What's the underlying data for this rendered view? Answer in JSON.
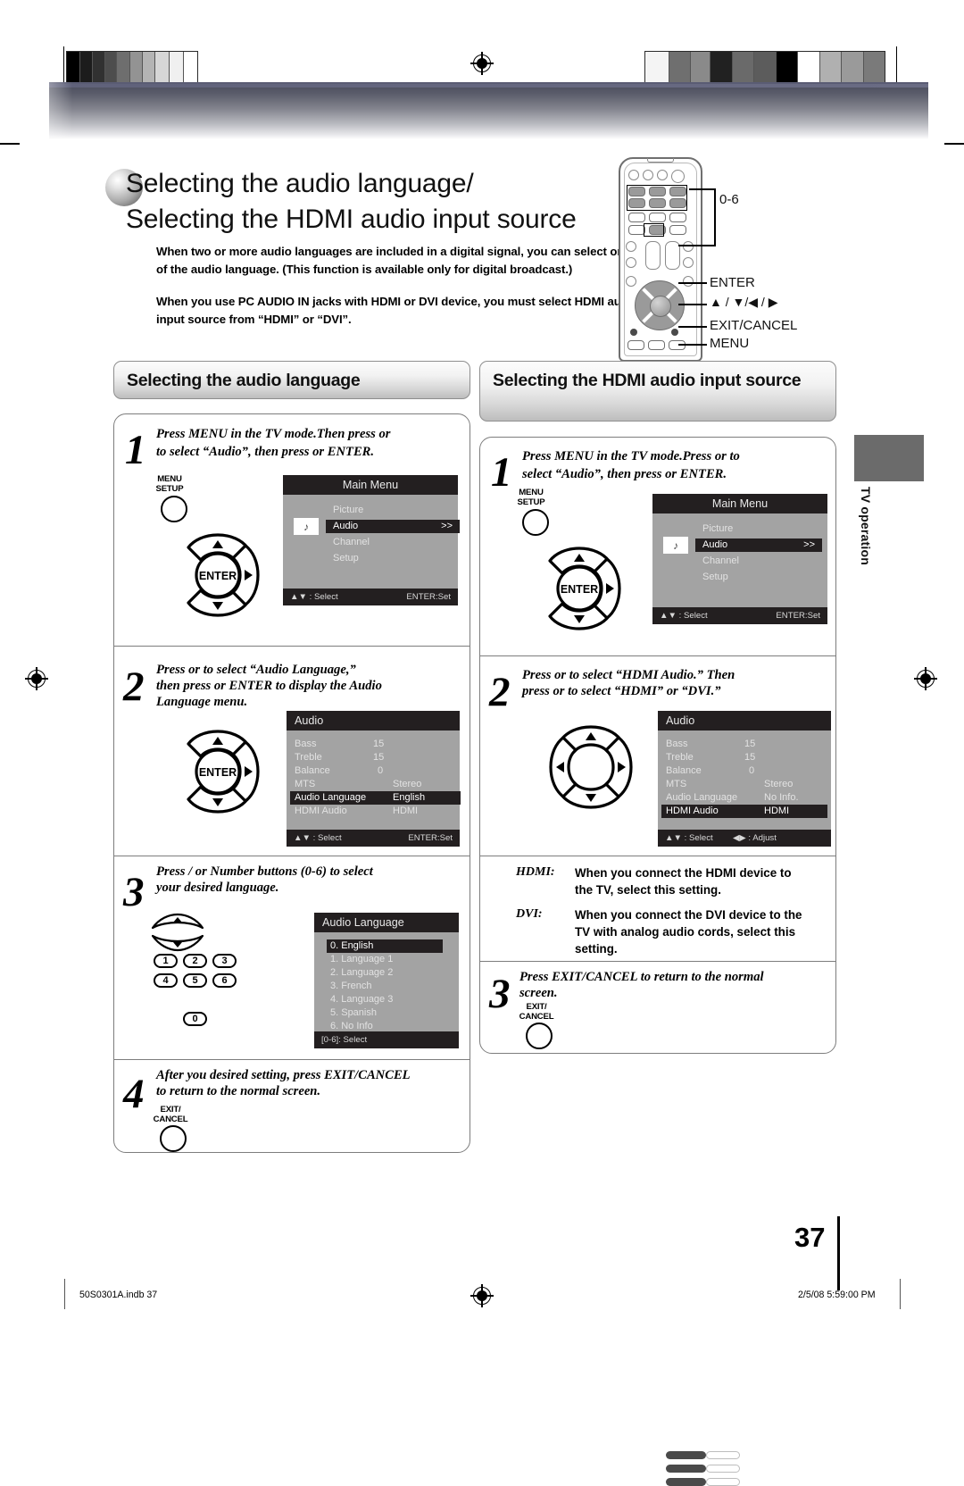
{
  "document": {
    "title_line1": "Selecting the audio language/",
    "title_line2": "Selecting the HDMI audio input source",
    "intro_paragraph_1": "When two or more audio languages are included in a digital signal, you can select one of the audio language. (This function is available only for digital broadcast.)",
    "intro_paragraph_2": "When you use PC AUDIO IN jacks with HDMI or DVI device, you must select HDMI audio input source from “HDMI” or “DVI”.",
    "side_tab_label": "TV operation",
    "page_number": "37",
    "footer_left": "50S0301A.indb   37",
    "footer_right": "2/5/08   5:59:00 PM"
  },
  "remote_callouts": {
    "number_keys": "0-6",
    "enter": "ENTER",
    "arrows": "▲ / ▼/◀ / ▶",
    "exit_cancel": "EXIT/CANCEL",
    "menu": "MENU"
  },
  "left_section": {
    "heading": "Selecting the audio language",
    "steps": [
      {
        "number": "1",
        "text_line1": "Press MENU in the TV mode.Then press           or",
        "text_line2": "to select “Audio”, then press                or ENTER.",
        "key_label_line1": "MENU",
        "key_label_line2": "SETUP",
        "dpad_center": "ENTER"
      },
      {
        "number": "2",
        "text_line1": "Press      or     to select “Audio Language,”",
        "text_line2": "then press        or ENTER to display the Audio",
        "text_line3": "Language menu.",
        "dpad_center": "ENTER"
      },
      {
        "number": "3",
        "text_line1": "Press    /   or Number buttons (0-6) to select",
        "text_line2": "your desired language.",
        "number_buttons": [
          "1",
          "2",
          "3",
          "4",
          "5",
          "6",
          "0"
        ]
      },
      {
        "number": "4",
        "text_line1": "After you desired setting, press EXIT/CANCEL",
        "text_line2": "to return to the normal screen.",
        "key_label_line1": "EXIT/",
        "key_label_line2": "CANCEL"
      }
    ]
  },
  "right_section": {
    "heading": "Selecting the HDMI audio input source",
    "steps": [
      {
        "number": "1",
        "text_line1": "Press MENU in the TV mode.Press            or      to",
        "text_line2": "select “Audio”, then press               or ENTER.",
        "key_label_line1": "MENU",
        "key_label_line2": "SETUP",
        "dpad_center": "ENTER"
      },
      {
        "number": "2",
        "text_line1": "Press      or      to select “HDMI Audio.” Then",
        "text_line2": "press      or      to select “HDMI” or “DVI.”"
      },
      {
        "number": "3",
        "text_line1": "Press EXIT/CANCEL to return to the normal",
        "text_line2": "screen.",
        "key_label_line1": "EXIT/",
        "key_label_line2": "CANCEL"
      }
    ],
    "definitions": [
      {
        "term": "HDMI:",
        "text_line1": "When you connect the HDMI device to",
        "text_line2": "the TV, select this setting."
      },
      {
        "term": "DVI:",
        "text_line1": "When you connect the DVI device to the",
        "text_line2": "TV with analog audio cords, select this",
        "text_line3": "setting."
      }
    ]
  },
  "osd": {
    "main_menu": {
      "title": "Main Menu",
      "items": [
        "Picture",
        "Audio",
        "Channel",
        "Setup"
      ],
      "selected_item": "Audio",
      "selected_arrow": ">>",
      "footer_left": "▲▼ : Select",
      "footer_right": "ENTER:Set"
    },
    "audio_left": {
      "title": "Audio",
      "rows": [
        {
          "label": "Bass",
          "value": "15"
        },
        {
          "label": "Treble",
          "value": "15"
        },
        {
          "label": "Balance",
          "value": "0"
        },
        {
          "label": "MTS",
          "value": "Stereo"
        },
        {
          "label": "Audio Language",
          "value": "English"
        },
        {
          "label": "HDMI Audio",
          "value": "HDMI"
        }
      ],
      "selected_label": "Audio Language",
      "footer_left": "▲▼ : Select",
      "footer_right": "ENTER:Set"
    },
    "audio_right": {
      "title": "Audio",
      "rows": [
        {
          "label": "Bass",
          "value": "15"
        },
        {
          "label": "Treble",
          "value": "15"
        },
        {
          "label": "Balance",
          "value": "0"
        },
        {
          "label": "MTS",
          "value": "Stereo"
        },
        {
          "label": "Audio Language",
          "value": "No Info."
        },
        {
          "label": "HDMI Audio",
          "value": "HDMI"
        }
      ],
      "selected_label": "HDMI Audio",
      "footer_left": "▲▼ : Select",
      "footer_mid": "◀▶ : Adjust"
    },
    "audio_language": {
      "title": "Audio Language",
      "items": [
        "0. English",
        "1. Language 1",
        "2. Language 2",
        "3. French",
        "4. Language 3",
        "5. Spanish",
        "6. No Info"
      ],
      "selected_item": "0. English",
      "footer_left": "[0-6]: Select"
    }
  },
  "colors": {
    "osd_background": "#a3a3a3",
    "osd_bar": "#231f20",
    "side_tab": "#6b6b6b"
  }
}
